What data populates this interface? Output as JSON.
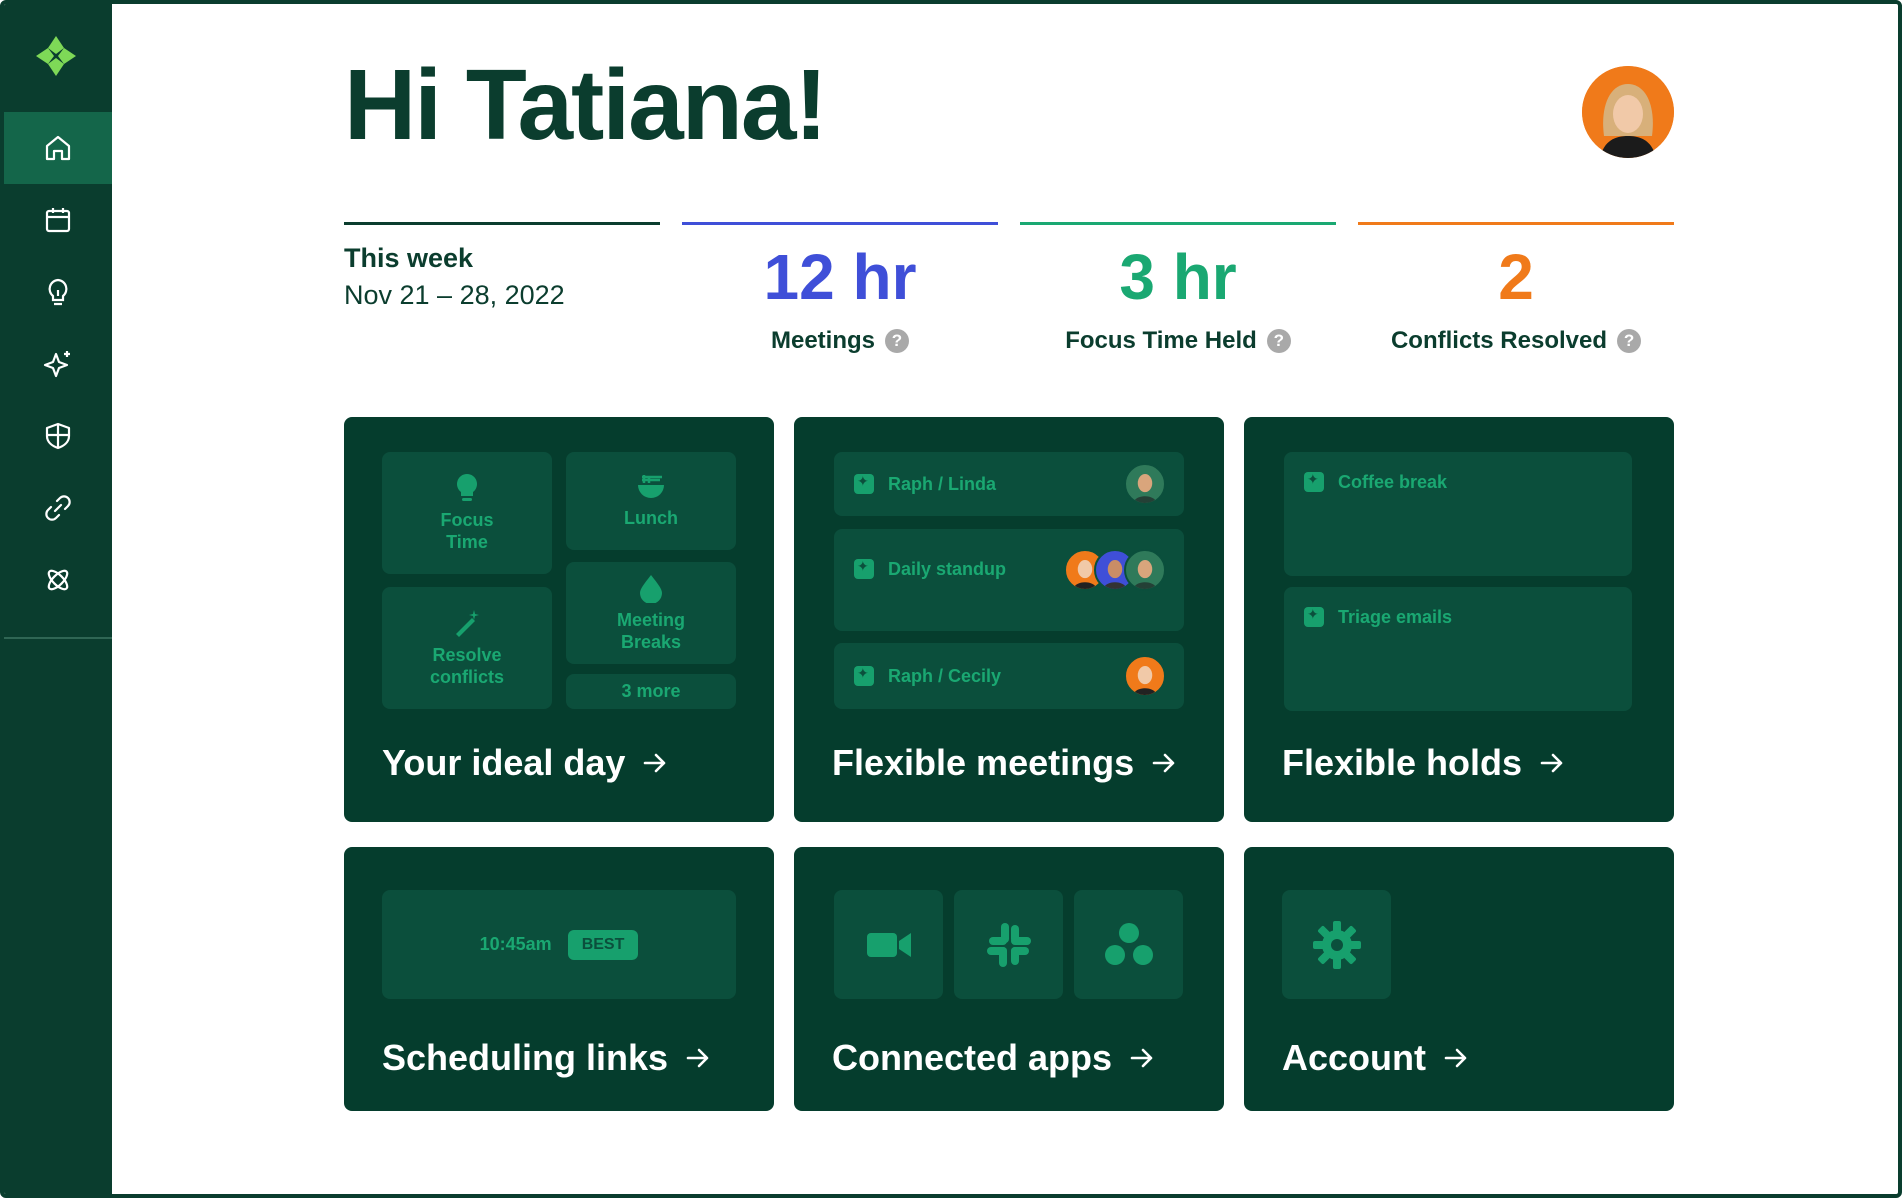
{
  "header": {
    "greeting": "Hi Tatiana!"
  },
  "stats": {
    "week_title": "This week",
    "week_range": "Nov 21 – 28, 2022",
    "meetings_value": "12 hr",
    "meetings_label": "Meetings",
    "focus_value": "3 hr",
    "focus_label": "Focus Time Held",
    "conflicts_value": "2",
    "conflicts_label": "Conflicts Resolved",
    "help_glyph": "?"
  },
  "colors": {
    "sidebar_bg": "#0a3d2e",
    "card_bg": "#053d2d",
    "tile_bg": "#0b4f3c",
    "accent_green": "#1aa872",
    "meetings_blue": "#3f4fd8",
    "focus_green": "#1aa872",
    "conflicts_orange": "#f07a1a"
  },
  "sidebar": {
    "items": [
      {
        "icon": "home-icon"
      },
      {
        "icon": "calendar-icon"
      },
      {
        "icon": "lightbulb-icon"
      },
      {
        "icon": "sparkle-icon"
      },
      {
        "icon": "shield-icon"
      },
      {
        "icon": "link-icon"
      },
      {
        "icon": "atom-icon"
      }
    ]
  },
  "ideal_day": {
    "title": "Your ideal day",
    "tiles": {
      "focus": "Focus\nTime",
      "lunch": "Lunch",
      "resolve": "Resolve\nconflicts",
      "breaks": "Meeting\nBreaks",
      "more": "3 more"
    }
  },
  "flexible_meetings": {
    "title": "Flexible meetings",
    "events": [
      "Raph / Linda",
      "Daily standup",
      "Raph / Cecily"
    ]
  },
  "flexible_holds": {
    "title": "Flexible holds",
    "events": [
      "Coffee break",
      "Triage emails"
    ]
  },
  "scheduling_links": {
    "title": "Scheduling links",
    "time": "10:45am",
    "badge": "BEST"
  },
  "connected_apps": {
    "title": "Connected apps",
    "apps": [
      "video-icon",
      "slack-icon",
      "asana-icon"
    ]
  },
  "account": {
    "title": "Account"
  }
}
